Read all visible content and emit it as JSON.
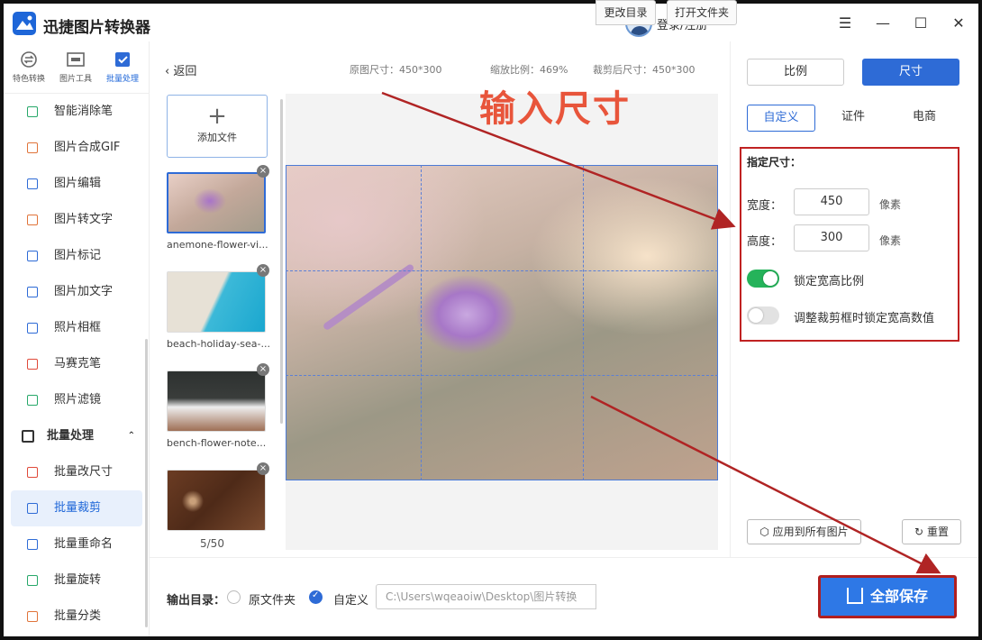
{
  "app": {
    "title": "迅捷图片转换器",
    "login": "登录/注册"
  },
  "window": {
    "menu": "☰",
    "minimize": "—",
    "maximize": "☐",
    "close": "✕"
  },
  "topnav": [
    {
      "label": "特色转换",
      "icon": "convert-icon"
    },
    {
      "label": "图片工具",
      "icon": "image-tool-icon"
    },
    {
      "label": "批量处理",
      "icon": "batch-icon"
    }
  ],
  "nav": {
    "items": [
      {
        "label": "智能消除笔",
        "color": "#27a86a"
      },
      {
        "label": "图片合成GIF",
        "color": "#e0743a"
      },
      {
        "label": "图片编辑",
        "color": "#2e6bd6"
      },
      {
        "label": "图片转文字",
        "color": "#e0743a"
      },
      {
        "label": "图片标记",
        "color": "#2e6bd6"
      },
      {
        "label": "图片加文字",
        "color": "#2e6bd6"
      },
      {
        "label": "照片相框",
        "color": "#2e6bd6"
      },
      {
        "label": "马赛克笔",
        "color": "#e04a3a"
      },
      {
        "label": "照片滤镜",
        "color": "#27a86a"
      }
    ],
    "section": "批量处理",
    "sub_items": [
      {
        "label": "批量改尺寸",
        "color": "#e04a3a"
      },
      {
        "label": "批量裁剪",
        "color": "#2e6bd6"
      },
      {
        "label": "批量重命名",
        "color": "#2e6bd6"
      },
      {
        "label": "批量旋转",
        "color": "#27a86a"
      },
      {
        "label": "批量分类",
        "color": "#e0743a"
      }
    ]
  },
  "header": {
    "back": "返回",
    "orig_size": "原图尺寸：450*300",
    "zoom": "缩放比例：469%",
    "crop_size": "裁剪后尺寸：450*300"
  },
  "files": {
    "add_label": "添加文件",
    "items": [
      {
        "name": "anemone-flower-vi..."
      },
      {
        "name": "beach-holiday-sea-..."
      },
      {
        "name": "bench-flower-note..."
      },
      {
        "name": ""
      }
    ],
    "page": "5/50"
  },
  "annotation": "输入尺寸",
  "right": {
    "seg_ratio": "比例",
    "seg_size": "尺寸",
    "tab_custom": "自定义",
    "tab_cert": "证件",
    "tab_ecom": "电商",
    "spec_title": "指定尺寸：",
    "width_label": "宽度：",
    "width_value": "450",
    "height_label": "高度：",
    "height_value": "300",
    "unit": "像素",
    "lock_ratio": "锁定宽高比例",
    "lock_crop": "调整裁剪框时锁定宽高数值",
    "apply_all": "应用到所有图片",
    "reset": "重置"
  },
  "bottom": {
    "out_label": "输出目录：",
    "opt_orig": "原文件夹",
    "opt_custom": "自定义",
    "path": "C:\\Users\\wqeaoiw\\Desktop\\图片转换",
    "change_dir": "更改目录",
    "open_folder": "打开文件夹",
    "save_all": "全部保存"
  },
  "colors": {
    "accent": "#2e6bd6",
    "annotation": "#e8553b",
    "highlight": "#c02222",
    "toggle_on": "#25b35a"
  }
}
